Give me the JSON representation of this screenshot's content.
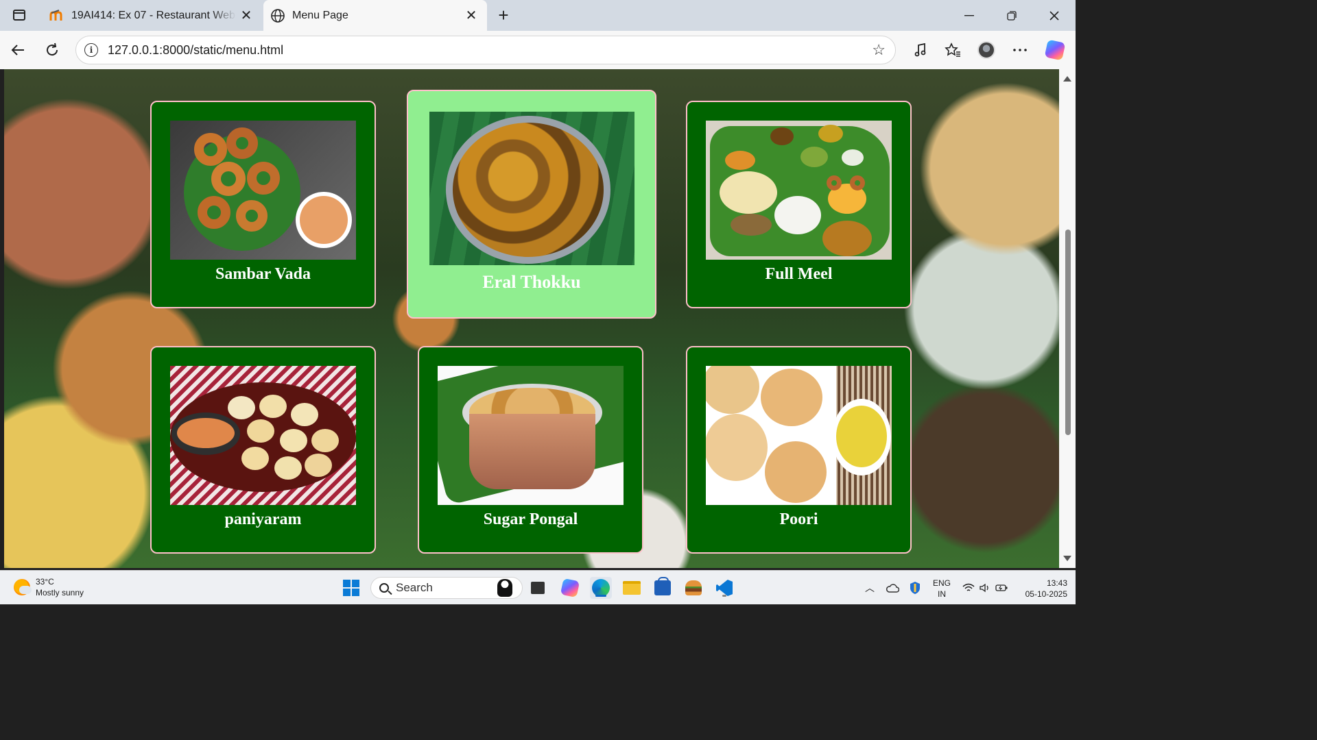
{
  "browser": {
    "tabs": [
      {
        "title": "19AI414: Ex 07 - Restaurant Webs",
        "active": false,
        "icon": "moodle-icon"
      },
      {
        "title": "Menu Page",
        "active": true,
        "icon": "globe-icon"
      }
    ],
    "url": "127.0.0.1:8000/static/menu.html"
  },
  "menu": {
    "items": [
      {
        "name": "Sambar Vada",
        "hovered": false
      },
      {
        "name": "Eral Thokku",
        "hovered": true
      },
      {
        "name": "Full Meel",
        "hovered": false
      },
      {
        "name": "paniyaram",
        "hovered": false
      },
      {
        "name": "Sugar Pongal",
        "hovered": false
      },
      {
        "name": "Poori",
        "hovered": false
      }
    ],
    "colors": {
      "card_bg": "#006400",
      "card_hover_bg": "#90ee90",
      "card_border": "#ffc0cb",
      "text": "#ffffff"
    }
  },
  "taskbar": {
    "weather": {
      "temp": "33°C",
      "desc": "Mostly sunny"
    },
    "search_placeholder": "Search",
    "lang": {
      "line1": "ENG",
      "line2": "IN"
    },
    "time": "13:43",
    "date": "05-10-2025"
  }
}
